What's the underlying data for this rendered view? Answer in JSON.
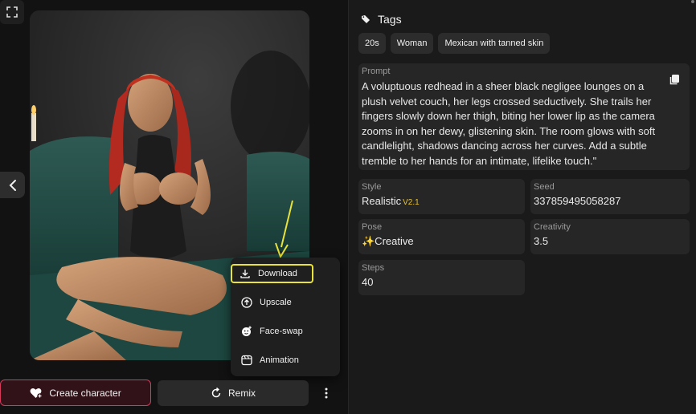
{
  "left": {
    "fullscreen_icon": "expand-icon",
    "back_icon": "chevron-left-icon",
    "image_alt": "Generated character image"
  },
  "menu": {
    "items": [
      {
        "label": "Download",
        "icon": "download-icon"
      },
      {
        "label": "Upscale",
        "icon": "upscale-icon"
      },
      {
        "label": "Face-swap",
        "icon": "face-swap-icon"
      },
      {
        "label": "Animation",
        "icon": "animation-icon"
      }
    ]
  },
  "actions": {
    "create_label": "Create character",
    "remix_label": "Remix",
    "more_icon": "more-vertical-icon"
  },
  "tags": {
    "title": "Tags",
    "items": [
      "20s",
      "Woman",
      "Mexican with tanned skin"
    ]
  },
  "prompt": {
    "label": "Prompt",
    "text": "A voluptuous redhead in a sheer black negligee lounges on a plush velvet couch, her legs crossed seductively. She trails her fingers slowly down her thigh, biting her lower lip as the camera zooms in on her dewy, glistening skin. The room glows with soft candlelight, shadows dancing across her curves. Add a subtle tremble to her hands for an intimate, lifelike touch.\""
  },
  "details": {
    "style_label": "Style",
    "style_value": "Realistic",
    "style_version": "V2.1",
    "seed_label": "Seed",
    "seed_value": "337859495058287",
    "pose_label": "Pose",
    "pose_value": "✨Creative",
    "creativity_label": "Creativity",
    "creativity_value": "3.5",
    "steps_label": "Steps",
    "steps_value": "40"
  },
  "colors": {
    "accent_create": "#d63a5a",
    "highlight": "#e8e23a",
    "version_badge": "#e6c335"
  }
}
